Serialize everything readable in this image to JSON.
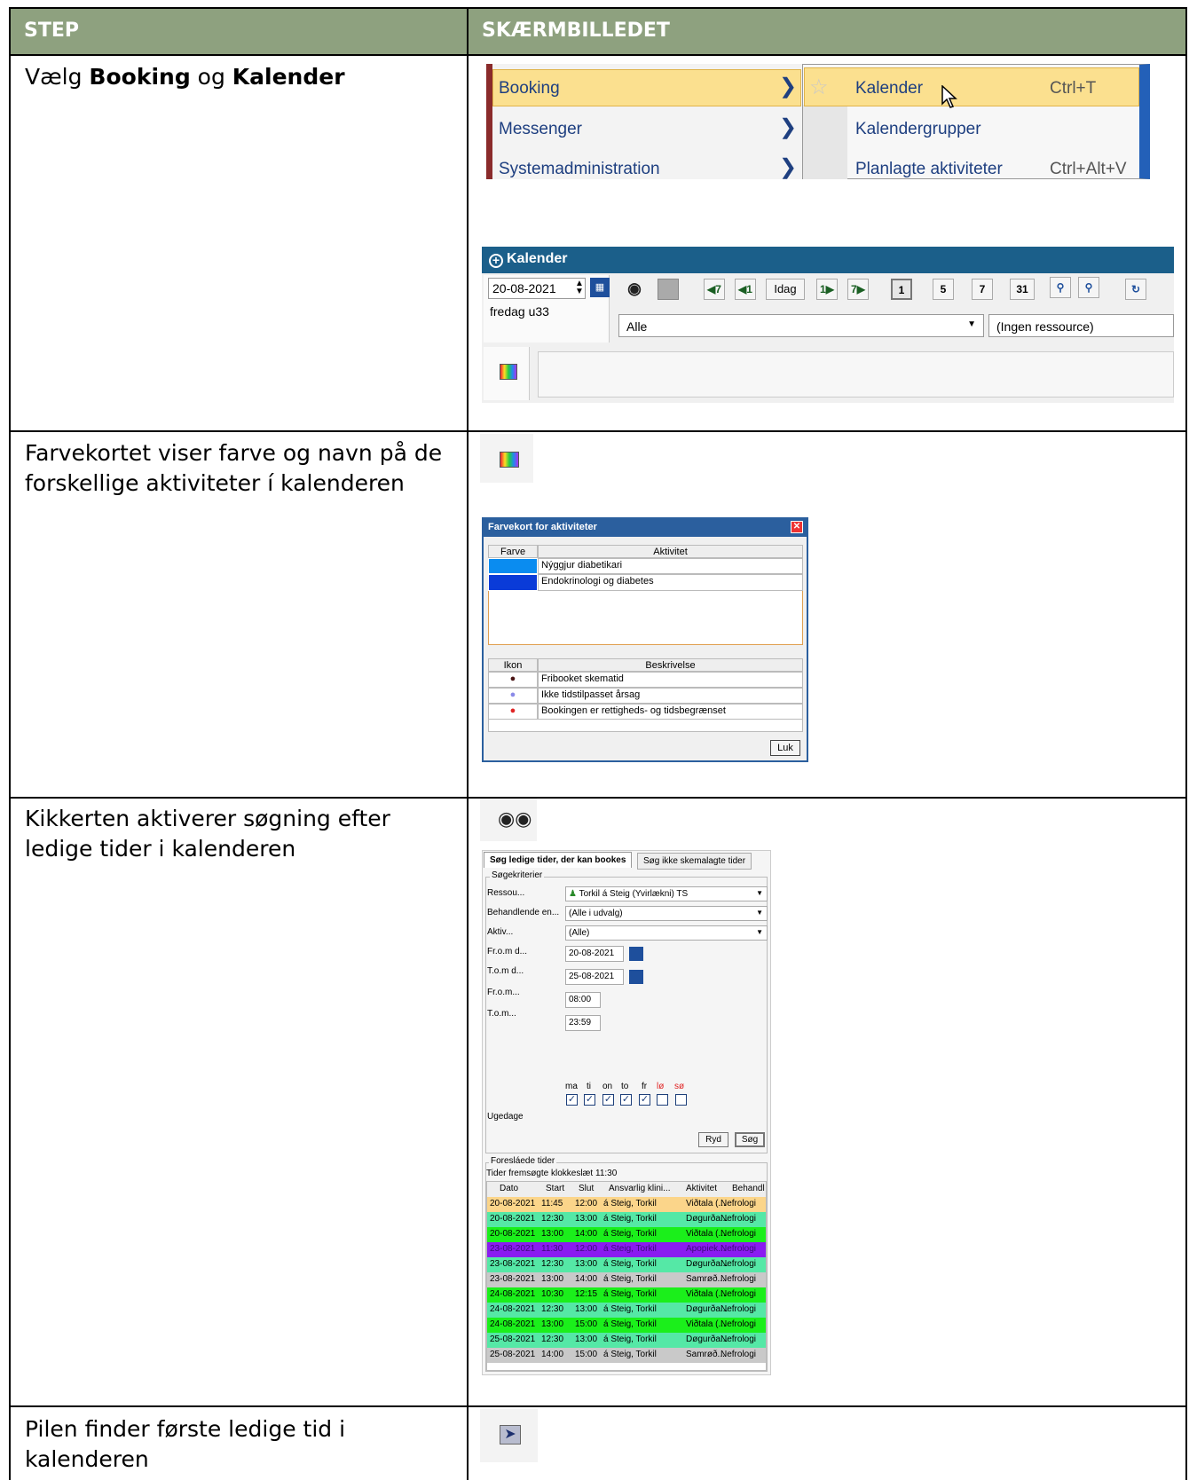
{
  "header": {
    "step": "STEP",
    "screen": "SKÆRMBILLEDET"
  },
  "rows": [
    {
      "pre": "Vælg ",
      "b1": "Booking",
      "mid": " og ",
      "b2": "Kalender"
    },
    {
      "text_l1": "Farvekortet viser farve og navn på de",
      "text_l2": "forskellige aktiviteter í kalenderen"
    },
    {
      "text_l1": "Kikkerten aktiverer søgning efter",
      "text_l2": "ledige tider i kalenderen"
    },
    {
      "text_l1": "Pilen finder første ledige tid i",
      "text_l2": "kalenderen"
    }
  ],
  "menu": {
    "left": [
      "Booking",
      "Messenger",
      "Systemadministration"
    ],
    "right": [
      {
        "label": "Kalender",
        "shortcut": "Ctrl+T"
      },
      {
        "label": "Kalendergrupper",
        "shortcut": ""
      },
      {
        "label": "Planlagte aktiviteter",
        "shortcut": "Ctrl+Alt+V"
      }
    ]
  },
  "kalender": {
    "title": "Kalender",
    "date": "20-08-2021",
    "weekday": "fredag u33",
    "today_btn": "Idag",
    "view_btns": [
      "1",
      "5",
      "7",
      "31"
    ],
    "filter": "Alle",
    "resource": "(Ingen ressource)"
  },
  "farvekort": {
    "title": "Farvekort for aktiviteter",
    "col_farve": "Farve",
    "col_aktivitet": "Aktivitet",
    "activities": [
      {
        "name": "Nýggjur diabetikari",
        "color": "#0a8cf0"
      },
      {
        "name": "Endokrinologi og diabetes",
        "color": "#0a3bd8"
      }
    ],
    "col_ikon": "Ikon",
    "col_beskrivelse": "Beskrivelse",
    "icons": [
      {
        "desc": "Fribooket skematid",
        "color": "#4a1515"
      },
      {
        "desc": "Ikke tidstilpasset årsag",
        "color": "#8a8ae8"
      },
      {
        "desc": "Bookingen er rettigheds- og tidsbegrænset",
        "color": "#e02525"
      }
    ],
    "close": "Luk"
  },
  "search": {
    "tab1": "Søg ledige tider, der kan bookes",
    "tab2": "Søg ikke skemalagte tider",
    "group": "Søgekriterier",
    "labels": [
      "Ressou...",
      "Behandlende en...",
      "Aktiv...",
      "Fr.o.m d...",
      "T.o.m d...",
      "Fr.o.m...",
      "T.o.m..."
    ],
    "ressource": "Torkil á Steig (Yvirlækni) TS",
    "behandlende": "(Alle i udvalg)",
    "aktiv": "(Alle)",
    "from_date": "20-08-2021",
    "to_date": "25-08-2021",
    "from_time": "08:00",
    "to_time": "23:59",
    "days": [
      "ma",
      "ti",
      "on",
      "to",
      "fr",
      "lø",
      "sø"
    ],
    "ugedage": "Ugedage",
    "btn_ryd": "Ryd",
    "btn_sog": "Søg",
    "results_group": "Foresláede tider",
    "results_note": "Tider fremsøgte klokkeslæt 11:30",
    "cols": [
      "Dato",
      "Start",
      "Slut",
      "Ansvarlig klini...",
      "Aktivitet",
      "Behandl"
    ],
    "rows": [
      {
        "d": "20-08-2021",
        "s": "11:45",
        "e": "12:00",
        "a": "á Steig, Torkil",
        "k": "Viðtala (...",
        "b": "Nefrologi",
        "bg": "#fbd58a"
      },
      {
        "d": "20-08-2021",
        "s": "12:30",
        "e": "13:00",
        "a": "á Steig, Torkil",
        "k": "Døgurða...",
        "b": "Nefrologi",
        "bg": "#55e8a6"
      },
      {
        "d": "20-08-2021",
        "s": "13:00",
        "e": "14:00",
        "a": "á Steig, Torkil",
        "k": "Viðtala (...",
        "b": "Nefrologi",
        "bg": "#1bef1b"
      },
      {
        "d": "23-08-2021",
        "s": "11:30",
        "e": "12:00",
        "a": "á Steig, Torkil",
        "k": "Apopiek...",
        "b": "Nefrologi",
        "bg": "#8a1cf0"
      },
      {
        "d": "23-08-2021",
        "s": "12:30",
        "e": "13:00",
        "a": "á Steig, Torkil",
        "k": "Døgurða...",
        "b": "Nefrologi",
        "bg": "#55e8a6"
      },
      {
        "d": "23-08-2021",
        "s": "13:00",
        "e": "14:00",
        "a": "á Steig, Torkil",
        "k": "Samrøð...",
        "b": "Nefrologi",
        "bg": "#c9c9c9"
      },
      {
        "d": "24-08-2021",
        "s": "10:30",
        "e": "12:15",
        "a": "á Steig, Torkil",
        "k": "Viðtala (...",
        "b": "Nefrologi",
        "bg": "#1bef1b"
      },
      {
        "d": "24-08-2021",
        "s": "12:30",
        "e": "13:00",
        "a": "á Steig, Torkil",
        "k": "Døgurða...",
        "b": "Nefrologi",
        "bg": "#55e8a6"
      },
      {
        "d": "24-08-2021",
        "s": "13:00",
        "e": "15:00",
        "a": "á Steig, Torkil",
        "k": "Viðtala (...",
        "b": "Nefrologi",
        "bg": "#1bef1b"
      },
      {
        "d": "25-08-2021",
        "s": "12:30",
        "e": "13:00",
        "a": "á Steig, Torkil",
        "k": "Døgurða...",
        "b": "Nefrologi",
        "bg": "#55e8a6"
      },
      {
        "d": "25-08-2021",
        "s": "14:00",
        "e": "15:00",
        "a": "á Steig, Torkil",
        "k": "Samrøð...",
        "b": "Nefrologi",
        "bg": "#c9c9c9"
      }
    ]
  }
}
